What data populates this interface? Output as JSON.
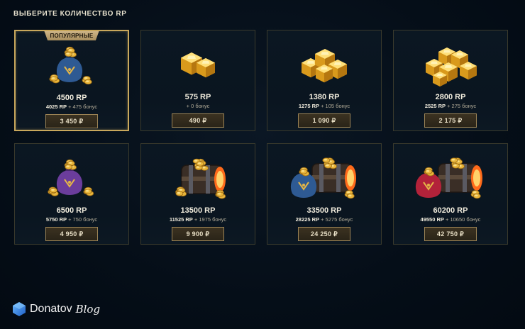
{
  "page": {
    "heading": "ВЫБЕРИТЕ КОЛИЧЕСТВО RP",
    "accent_color": "#c9a85c"
  },
  "packages": [
    {
      "name": "4500 RP",
      "base": "4025 RP",
      "bonus": "+ 475 бонус",
      "price": "3 450 ₽",
      "badge": "ПОПУЛЯРНЫЕ",
      "art": "blue-bag-gold-icon"
    },
    {
      "name": "575 RP",
      "base": "",
      "bonus": "+ 0 бонус",
      "price": "490 ₽",
      "badge": "",
      "art": "gold-crystal-small-icon"
    },
    {
      "name": "1380 RP",
      "base": "1275 RP",
      "bonus": "+ 105 бонус",
      "price": "1 090 ₽",
      "badge": "",
      "art": "gold-crystal-medium-icon"
    },
    {
      "name": "2800 RP",
      "base": "2525 RP",
      "bonus": "+ 275 бонус",
      "price": "2 175 ₽",
      "badge": "",
      "art": "gold-crystal-large-icon"
    },
    {
      "name": "6500 RP",
      "base": "5750 RP",
      "bonus": "+ 750 бонус",
      "price": "4 950 ₽",
      "badge": "",
      "art": "purple-bag-gold-icon"
    },
    {
      "name": "13500 RP",
      "base": "11525 RP",
      "bonus": "+ 1975 бонус",
      "price": "9 900 ₽",
      "badge": "",
      "art": "treasure-chest-icon"
    },
    {
      "name": "33500 RP",
      "base": "28225 RP",
      "bonus": "+ 5275 бонус",
      "price": "24 250 ₽",
      "badge": "",
      "art": "chest-blue-bag-icon"
    },
    {
      "name": "60200 RP",
      "base": "49550 RP",
      "bonus": "+ 10650 бонус",
      "price": "42 750 ₽",
      "badge": "",
      "art": "chest-red-bag-icon"
    }
  ],
  "watermark": {
    "name": "Donatov",
    "blog": "Blog"
  }
}
